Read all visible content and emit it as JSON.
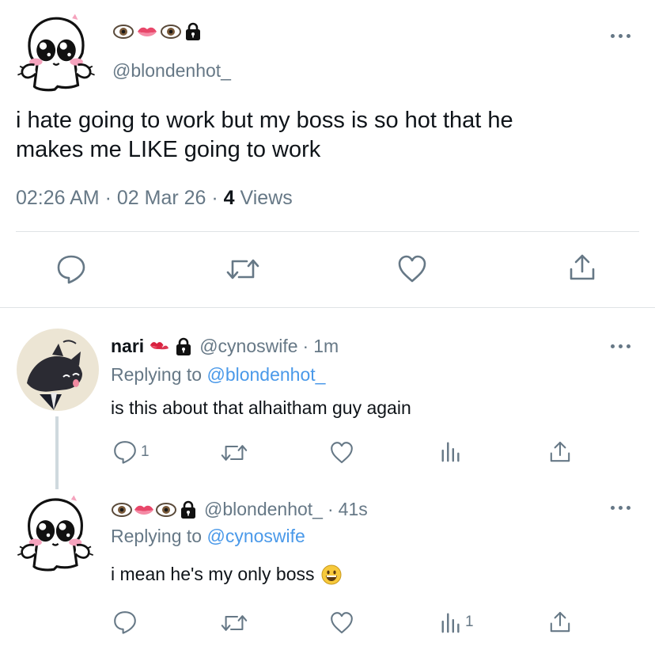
{
  "main_tweet": {
    "handle": "@blondenhot_",
    "text_line1": "i hate going to work but my boss is so hot that he",
    "text_line2": "makes me LIKE going to work",
    "time": "02:26 AM",
    "sep1": "·",
    "date": "02 Mar 26",
    "sep2": "·",
    "views_count": "4",
    "views_label": "Views"
  },
  "reply1": {
    "name": "nari",
    "handle": "@cynoswife",
    "sep": "·",
    "time": "1m",
    "replying_prefix": "Replying to",
    "replying_to": "@blondenhot_",
    "text": "is this about that alhaitham guy again",
    "reply_count": "1"
  },
  "reply2": {
    "handle": "@blondenhot_",
    "sep": "·",
    "time": "41s",
    "replying_prefix": "Replying to",
    "replying_to": "@cynoswife",
    "text": "i mean he's my only boss",
    "views_count": "1"
  },
  "colors": {
    "text": "#0f1419",
    "secondary": "#667886",
    "link": "#4a99e9",
    "divider": "#dfe3e6"
  },
  "icons": [
    "eye-icon",
    "lips-icon",
    "lock-icon",
    "kiss-mark-icon",
    "grinning-face-icon",
    "reply-icon",
    "retweet-icon",
    "like-icon",
    "share-icon",
    "views-icon",
    "more-icon"
  ]
}
